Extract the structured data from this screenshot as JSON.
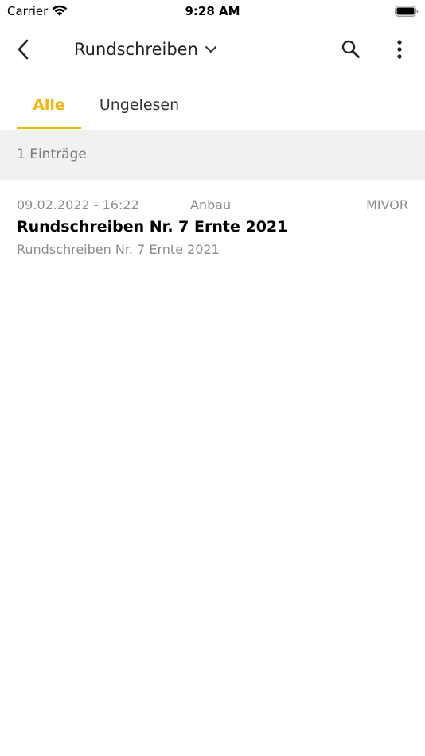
{
  "status_bar": {
    "carrier": "Carrier",
    "time": "9:28 AM",
    "icons": [
      "wifi-icon",
      "battery-icon"
    ]
  },
  "nav": {
    "title": "Rundschreiben",
    "icons": [
      "back-chevron-icon",
      "chevron-down-icon",
      "search-icon",
      "more-vertical-icon"
    ]
  },
  "tabs": [
    {
      "label": "Alle",
      "active": true
    },
    {
      "label": "Ungelesen",
      "active": false
    }
  ],
  "colors": {
    "accent": "#f2b705",
    "muted_text": "#8c8c8c",
    "count_background": "#f1f1f1"
  },
  "list": {
    "count_label": "1 Einträge",
    "items": [
      {
        "date": "09.02.2022 - 16:22",
        "category": "Anbau",
        "sender": "MIVOR",
        "title": "Rundschreiben Nr. 7 Ernte 2021",
        "subtitle": "Rundschreiben Nr. 7 Ernte 2021"
      }
    ]
  }
}
